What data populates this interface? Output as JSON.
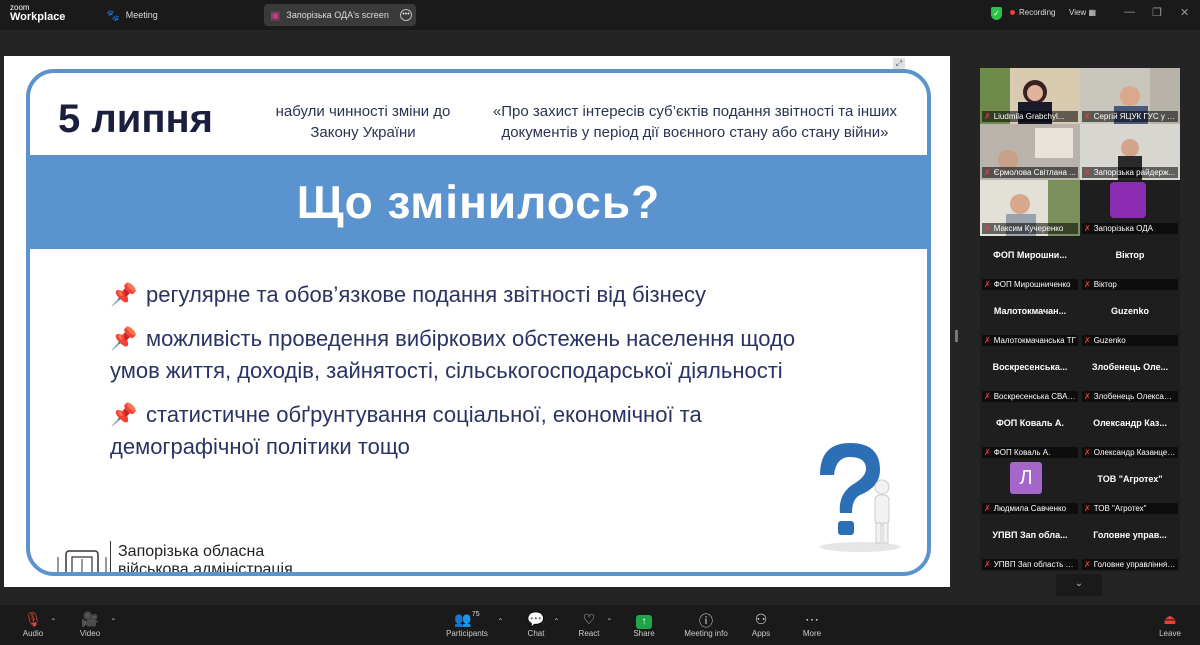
{
  "app": {
    "brand_top": "zoom",
    "brand_bottom": "Workplace"
  },
  "tabs": [
    {
      "label": "Meeting"
    },
    {
      "label": "Запорізька ОДА's screen"
    }
  ],
  "status": {
    "recording": "Recording",
    "view": "View"
  },
  "slide": {
    "date": "5 липня",
    "intro": "набули чинності зміни до Закону України",
    "law_title": "«Про захист інтересів суб’єктів подання звітності та інших документів у період дії воєнного стану або стану війни»",
    "headline": "Що змінилось?",
    "bullets": [
      "регулярне та обов’язкове подання звітності від бізнесу",
      "можливість проведення вибіркових обстежень населення щодо умов життя, доходів, зайнятості, сільськогосподарської діяльності",
      "статистичне обґрунтування соціальної, економічної та демографічної політики тощо"
    ],
    "footer_line1": "Запорізька обласна",
    "footer_line2": "військова адміністрація"
  },
  "participants": [
    {
      "name": "Liudmila Grabchyl...",
      "big": ""
    },
    {
      "name": "Сергій ЯЦУК ГУС у Запо...",
      "big": ""
    },
    {
      "name": "Єрмолова Світлана ...",
      "big": ""
    },
    {
      "name": "Запорізька райдерж...",
      "big": ""
    },
    {
      "name": "Максим Кучеренко",
      "big": ""
    },
    {
      "name": "Запорізька ОДА",
      "big": ""
    },
    {
      "name": "ФОП Мирошниченко",
      "big": "ФОП Мирошни..."
    },
    {
      "name": "Віктор",
      "big": "Віктор"
    },
    {
      "name": "Малотокмачанська ТГ",
      "big": "Малотокмачан..."
    },
    {
      "name": "Guzenko",
      "big": "Guzenko"
    },
    {
      "name": "Воскресенська СВА З...",
      "big": "Воскресенська..."
    },
    {
      "name": "Злобенець Олександ...",
      "big": "Злобенець Оле..."
    },
    {
      "name": "ФОП Коваль А.",
      "big": "ФОП Коваль А."
    },
    {
      "name": "Олександр Казанцев...",
      "big": "Олександр Каз..."
    },
    {
      "name": "Людмила Савченко",
      "big": "Л"
    },
    {
      "name": "ТОВ \"Агротех\"",
      "big": "ТОВ \"Агротех\""
    },
    {
      "name": "УПВП Зап область С...",
      "big": "УПВП Зап обла..."
    },
    {
      "name": "Головне управління ...",
      "big": "Головне управ..."
    }
  ],
  "toolbar": {
    "audio": "Audio",
    "video": "Video",
    "participants": "Participants",
    "participants_count": "75",
    "chat": "Chat",
    "react": "React",
    "share": "Share",
    "meeting_info": "Meeting info",
    "apps": "Apps",
    "more": "More",
    "leave": "Leave"
  },
  "colors": {
    "accent_blue": "#5b93cf",
    "recording_red": "#e8403a",
    "share_green": "#1fa64a"
  }
}
